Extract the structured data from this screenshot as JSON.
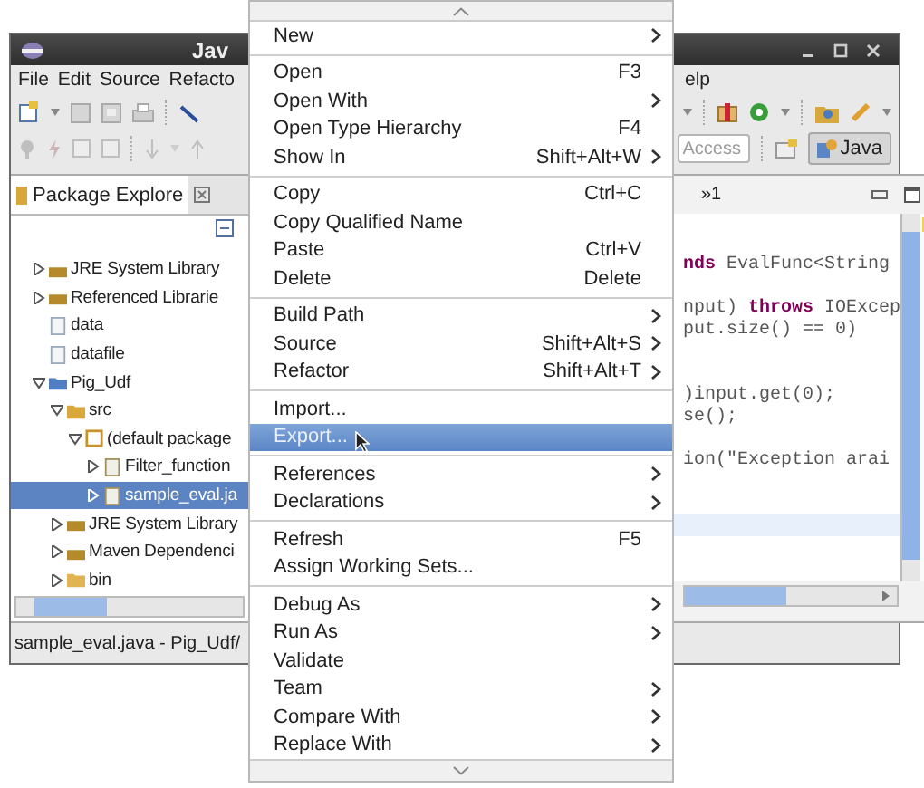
{
  "window": {
    "title": "Jav"
  },
  "menubar": {
    "items": [
      {
        "label": "File"
      },
      {
        "label": "Edit"
      },
      {
        "label": "Source"
      },
      {
        "label": "Refacto"
      }
    ],
    "right_fragment": "elp"
  },
  "toolbar": {
    "quick_access": {
      "placeholder": "Access"
    },
    "perspective": {
      "label": "Java",
      "selected": true
    }
  },
  "package_explorer": {
    "tab": "Package Explore",
    "tree": [
      {
        "label": "JRE System Library",
        "kind": "library",
        "expanded": false,
        "selected": false
      },
      {
        "label": "Referenced Librarie",
        "kind": "library",
        "expanded": false,
        "selected": false
      },
      {
        "label": "data",
        "kind": "file",
        "selected": false
      },
      {
        "label": "datafile",
        "kind": "file",
        "selected": false
      },
      {
        "label": "Pig_Udf",
        "kind": "project",
        "expanded": true,
        "selected": false,
        "children": [
          {
            "label": "src",
            "kind": "source-folder",
            "expanded": true,
            "selected": false,
            "children": [
              {
                "label": "(default package",
                "kind": "package",
                "expanded": true,
                "selected": false,
                "children": [
                  {
                    "label": "Filter_function",
                    "kind": "java-file",
                    "expanded": false,
                    "selected": false
                  },
                  {
                    "label": "sample_eval.ja",
                    "kind": "java-file",
                    "expanded": false,
                    "selected": true
                  }
                ]
              }
            ]
          },
          {
            "label": "JRE System Library",
            "kind": "library",
            "expanded": false,
            "selected": false
          },
          {
            "label": "Maven Dependenci",
            "kind": "library",
            "expanded": false,
            "selected": false
          },
          {
            "label": "bin",
            "kind": "folder",
            "expanded": false,
            "selected": false
          }
        ]
      }
    ]
  },
  "editor": {
    "tab_overflow": "»1",
    "lines": [
      {
        "kind": "code",
        "text": "**nds** EvalFunc<String"
      },
      {
        "kind": "blank"
      },
      {
        "kind": "code",
        "text": "nput) **throws** IOExcep"
      },
      {
        "kind": "code",
        "text": "put.size() == 0)"
      },
      {
        "kind": "blank"
      },
      {
        "kind": "blank"
      },
      {
        "kind": "code",
        "text": ")input.get(0);"
      },
      {
        "kind": "code",
        "text": "se();"
      },
      {
        "kind": "blank"
      },
      {
        "kind": "code",
        "text": "ion(\"Exception arai"
      },
      {
        "kind": "blank"
      },
      {
        "kind": "blank"
      },
      {
        "kind": "current"
      }
    ]
  },
  "status_bar": "sample_eval.java - Pig_Udf/",
  "context_menu": {
    "groups": [
      [
        {
          "label": "New",
          "submenu": true,
          "selected": false
        }
      ],
      [
        {
          "label": "Open",
          "shortcut": "F3",
          "submenu": false,
          "selected": false
        },
        {
          "label": "Open With",
          "submenu": true,
          "selected": false
        },
        {
          "label": "Open Type Hierarchy",
          "shortcut": "F4",
          "submenu": false,
          "selected": false
        },
        {
          "label": "Show In",
          "shortcut": "Shift+Alt+W",
          "submenu": true,
          "selected": false
        }
      ],
      [
        {
          "label": "Copy",
          "shortcut": "Ctrl+C",
          "submenu": false,
          "selected": false
        },
        {
          "label": "Copy Qualified Name",
          "submenu": false,
          "selected": false
        },
        {
          "label": "Paste",
          "shortcut": "Ctrl+V",
          "submenu": false,
          "selected": false
        },
        {
          "label": "Delete",
          "shortcut": "Delete",
          "submenu": false,
          "selected": false
        }
      ],
      [
        {
          "label": "Build Path",
          "submenu": true,
          "selected": false
        },
        {
          "label": "Source",
          "shortcut": "Shift+Alt+S",
          "submenu": true,
          "selected": false
        },
        {
          "label": "Refactor",
          "shortcut": "Shift+Alt+T",
          "submenu": true,
          "selected": false
        }
      ],
      [
        {
          "label": "Import...",
          "submenu": false,
          "selected": false
        },
        {
          "label": "Export...",
          "submenu": false,
          "selected": true
        }
      ],
      [
        {
          "label": "References",
          "submenu": true,
          "selected": false
        },
        {
          "label": "Declarations",
          "submenu": true,
          "selected": false
        }
      ],
      [
        {
          "label": "Refresh",
          "shortcut": "F5",
          "submenu": false,
          "selected": false
        },
        {
          "label": "Assign Working Sets...",
          "submenu": false,
          "selected": false
        }
      ],
      [
        {
          "label": "Debug As",
          "submenu": true,
          "selected": false
        },
        {
          "label": "Run As",
          "submenu": true,
          "selected": false
        },
        {
          "label": "Validate",
          "submenu": false,
          "selected": false
        },
        {
          "label": "Team",
          "submenu": true,
          "selected": false
        },
        {
          "label": "Compare With",
          "submenu": true,
          "selected": false
        },
        {
          "label": "Replace With",
          "submenu": true,
          "selected": false
        }
      ]
    ]
  }
}
